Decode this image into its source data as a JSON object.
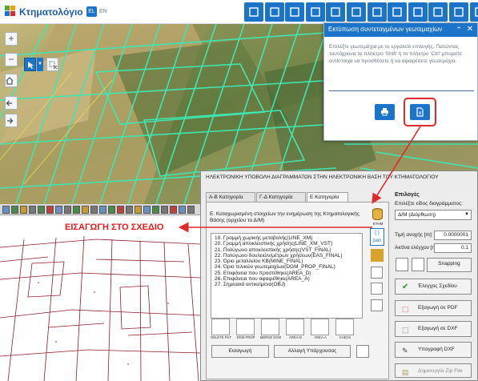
{
  "header": {
    "logo_text": "Κτηματολόγιο",
    "lang_active": "EL",
    "lang_other": "EN",
    "toolbar_icons": [
      "grid-icon",
      "layers-icon",
      "cursor-pencil-icon",
      "book-icon",
      "image-icon",
      "fill-icon",
      "ruler-icon",
      "draw-icon",
      "print-icon",
      "calculator-icon",
      "document-icon",
      "map-pin-icon"
    ]
  },
  "map_controls": {
    "zoom_in": "+",
    "zoom_out": "−"
  },
  "print_panel": {
    "title": "Εκτύπωση συντεταγμένων γεωτεμαχίων",
    "instructions": "Επιλέξτε γεωτεμάχια με το εργαλείο επιλογής. Πατώντας ταυτόχρονα το πλήκτρο 'Shift' ή το πλήκτρο 'Ctrl' μπορείτε αντίστοιχα να προσθέσετε ή να αφαιρέσετε γεωτεμάχια."
  },
  "cad": {
    "insert_label": "ΕΙΣΑΓΩΓΗ ΣΤΟ ΣΧΕΔΙΟ"
  },
  "dialog": {
    "title": "ΗΛΕΚΤΡΟΝΙΚΗ ΥΠΟΒΟΛΗ ΔΙΑΓΡΑΜΜΑΤΩΝ ΣΤΗΝ ΗΛΕΚΤΡΟΝΙΚΗ ΒΑΣΗ ΤΟΥ ΚΤΗΜΑΤΟΛΟΓΙΟΥ",
    "tabs": [
      "Α-Β Κατηγορία",
      "Γ-Δ Κατηγορία",
      "Ε Κατηγορία"
    ],
    "category_desc": "Ε. Καταχωρισμένη στοιχείων την ενημέρωση της Κτηματολογικής Βάσης (αρχείου το Δ/Μ)",
    "db_label": "ΚΤΗΜ",
    "json_label": "json",
    "layers": [
      "19. Γραμμή χωρικής μεταβολής(LINE_XM)",
      "20. Γραμμή αποκλειστικής χρήσης(LINE_XM_VST)",
      "21. Πολύγωνο αποκλειστικής χρήσης(VST_FINAL)",
      "22. Πολύγωνο δουλειών/μέτρων χρήσεων(EAS_FINAL)",
      "23. Όριο μεταλλείου ΚΒ(MINE_FINAL)",
      "24. Όριο τελικών γεωτεμαχίων(DGM_PROP_FINAL)",
      "25. Επιφάνεια που προστέθηκε(AREA_D)",
      "26. Επιφάνεια που αφαιρέθηκε(AREA_A)",
      "27. Σημειακά αντικείμενα(OBJ)"
    ],
    "list_tools": [
      "DELETE PST",
      "DGM PROP",
      "MERGE DGM",
      "AREA-D",
      "AREA-A",
      "CHECK"
    ],
    "insert_button": "Εισαγωγή",
    "change_button": "Αλλαγή Υπάρχουσας",
    "options": {
      "title": "Επιλογές",
      "prompt": "Επιλέξτε είδος διαγράμματος:",
      "diagram_type": "Δ/Μ (Διόρθωση)",
      "tolerance_label": "Τιμή ανοχής [m]:",
      "tolerance_value": "0.0000001",
      "radius_label": "Ακτίνα ελέγχου [m]:",
      "radius_value": "0.1",
      "snapping": "Snapping",
      "check_diagram": "Έλεγχος Σχεδίου",
      "export_pdf": "Εξαγωγή σε PDF",
      "export_dxf": "Εξαγωγή σε DXF",
      "sign_dxf": "Υπογραφή DXF",
      "create_zip": "Δημιουργία Zip File"
    }
  },
  "colors": {
    "accent_blue": "#1b74c9",
    "highlight_red": "#e0292c",
    "parcel_green": "#3fe6b0",
    "cad_line": "#8b1e2b"
  }
}
